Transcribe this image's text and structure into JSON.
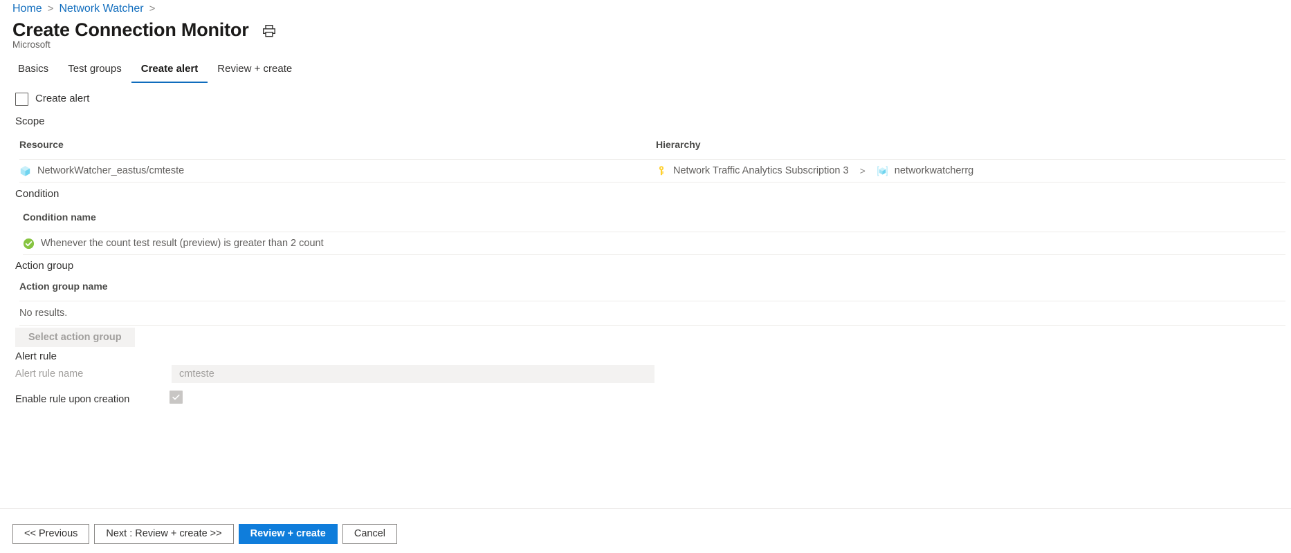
{
  "breadcrumb": {
    "items": [
      {
        "label": "Home"
      },
      {
        "label": "Network Watcher"
      }
    ],
    "separator": ">"
  },
  "header": {
    "title": "Create Connection Monitor",
    "subtitle": "Microsoft",
    "print_icon": "printer-icon"
  },
  "tabs": [
    {
      "label": "Basics",
      "active": false
    },
    {
      "label": "Test groups",
      "active": false
    },
    {
      "label": "Create alert",
      "active": true
    },
    {
      "label": "Review + create",
      "active": false
    }
  ],
  "create_alert": {
    "checkbox_label": "Create alert",
    "checked": false
  },
  "scope": {
    "section_label": "Scope",
    "columns": [
      "Resource",
      "Hierarchy"
    ],
    "rows": [
      {
        "resource_icon": "cube-icon",
        "resource": "NetworkWatcher_eastus/cmteste",
        "hierarchy_subscription_icon": "key-icon",
        "hierarchy_subscription": "Network Traffic Analytics Subscription 3",
        "hierarchy_separator": ">",
        "hierarchy_group_icon": "resource-group-icon",
        "hierarchy_group": "networkwatcherrg"
      }
    ]
  },
  "condition": {
    "section_label": "Condition",
    "column": "Condition name",
    "rows": [
      {
        "status_icon": "green-check-icon",
        "text": "Whenever the count test result (preview) is greater than 2 count"
      }
    ]
  },
  "action_group": {
    "section_label": "Action group",
    "column": "Action group name",
    "empty_text": "No results.",
    "select_button": "Select action group",
    "select_button_disabled": true
  },
  "alert_rule": {
    "section_label": "Alert rule",
    "name_label": "Alert rule name",
    "name_value": "cmteste",
    "enable_label": "Enable rule upon creation",
    "enable_checked": true,
    "enable_disabled": true
  },
  "footer": {
    "buttons": [
      {
        "label": "<< Previous",
        "style": "default"
      },
      {
        "label": "Next : Review + create >>",
        "style": "default"
      },
      {
        "label": "Review + create",
        "style": "primary"
      },
      {
        "label": "Cancel",
        "style": "default"
      }
    ]
  },
  "colors": {
    "link": "#0f6cbd",
    "accent": "#0f7ddb",
    "success": "#86c440",
    "divider": "#edebe9",
    "disabled_bg": "#f3f2f1",
    "disabled_text": "#a19f9d"
  }
}
